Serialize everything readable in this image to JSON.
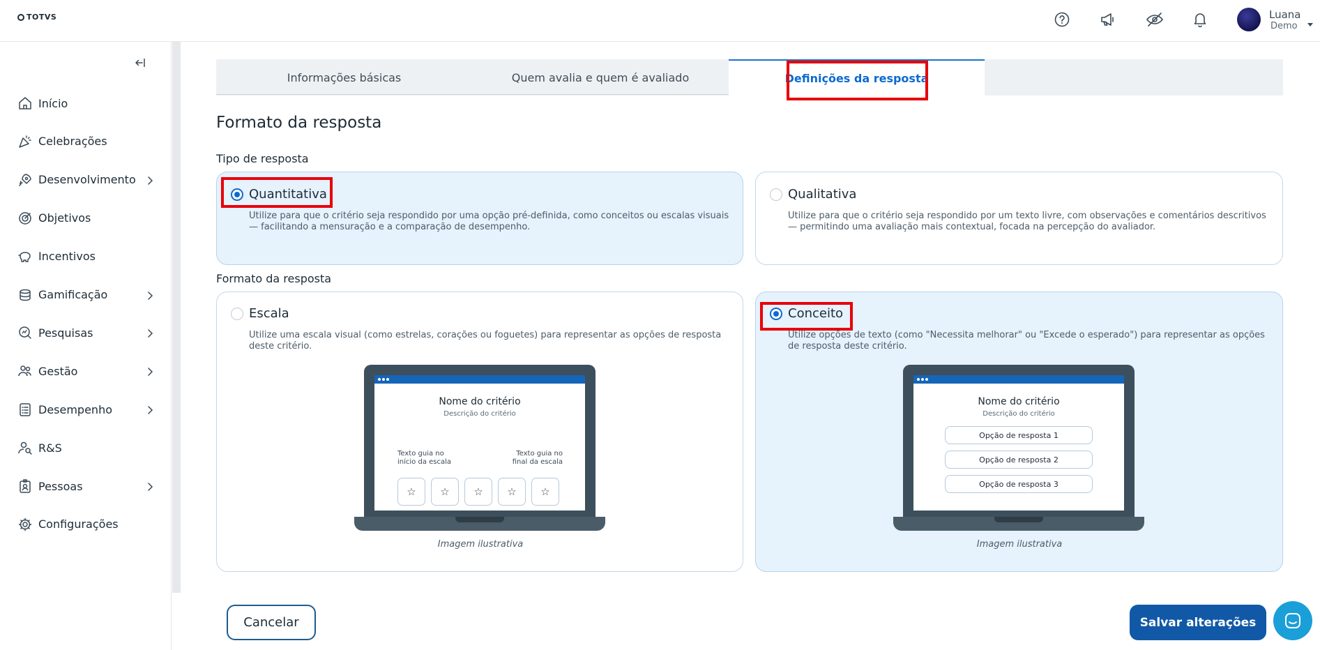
{
  "header": {
    "logo_text": "TOTVS",
    "user_name": "Luana",
    "user_role": "Demo",
    "icons": [
      "help-icon",
      "megaphone-icon",
      "hide-icon",
      "bell-icon"
    ]
  },
  "sidebar": {
    "items": [
      {
        "label": "Início",
        "icon": "home-icon",
        "chevron": false
      },
      {
        "label": "Celebrações",
        "icon": "party-icon",
        "chevron": false
      },
      {
        "label": "Desenvolvimento",
        "icon": "rocket-icon",
        "chevron": true
      },
      {
        "label": "Objetivos",
        "icon": "target-icon",
        "chevron": false
      },
      {
        "label": "Incentivos",
        "icon": "piggy-bank-icon",
        "chevron": false
      },
      {
        "label": "Gamificação",
        "icon": "coins-icon",
        "chevron": true
      },
      {
        "label": "Pesquisas",
        "icon": "search-doc-icon",
        "chevron": true
      },
      {
        "label": "Gestão",
        "icon": "people-icon",
        "chevron": true
      },
      {
        "label": "Desempenho",
        "icon": "checklist-icon",
        "chevron": true
      },
      {
        "label": "R&S",
        "icon": "user-search-icon",
        "chevron": false
      },
      {
        "label": "Pessoas",
        "icon": "badge-icon",
        "chevron": true
      },
      {
        "label": "Configurações",
        "icon": "gear-icon",
        "chevron": false
      }
    ]
  },
  "tabs": [
    {
      "label": "Informações básicas",
      "active": false
    },
    {
      "label": "Quem avalia e quem é avaliado",
      "active": false
    },
    {
      "label": "Definições da resposta",
      "active": true
    }
  ],
  "section": {
    "title": "Formato da resposta",
    "tipo_label": "Tipo de resposta",
    "formato_label": "Formato da resposta"
  },
  "tipo": {
    "quantitativa": {
      "title": "Quantitativa",
      "desc": "Utilize para que o critério seja respondido por uma opção pré-definida, como conceitos ou escalas visuais — facilitando a mensuração e a comparação de desempenho.",
      "selected": true
    },
    "qualitativa": {
      "title": "Qualitativa",
      "desc": "Utilize para que o critério seja respondido por um texto livre, com observações e comentários descritivos — permitindo uma avaliação mais contextual, focada na percepção do avaliador.",
      "selected": false
    }
  },
  "formato": {
    "escala": {
      "title": "Escala",
      "desc": "Utilize uma escala visual (como estrelas, corações ou foguetes) para representar as opções de resposta deste critério.",
      "selected": false,
      "preview": {
        "title": "Nome do critério",
        "subtitle": "Descrição do critério",
        "guide_start": "Texto guia no início da escala",
        "guide_end": "Texto guia no final da escala",
        "star": "☆"
      },
      "caption": "Imagem ilustrativa"
    },
    "conceito": {
      "title": "Conceito",
      "desc": "Utilize opções de texto (como \"Necessita melhorar\" ou \"Excede o esperado\") para representar as opções de resposta deste critério.",
      "selected": true,
      "preview": {
        "title": "Nome do critério",
        "subtitle": "Descrição do critério",
        "options": [
          "Opção de resposta 1",
          "Opção de resposta 2",
          "Opção de resposta 3"
        ]
      },
      "caption": "Imagem ilustrativa"
    }
  },
  "actions": {
    "cancel": "Cancelar",
    "save": "Salvar alterações"
  },
  "colors": {
    "accent": "#0c6ad0",
    "highlight": "#e8000a",
    "selected_card": "#e6f2fc",
    "save_button": "#1159a6",
    "chat_button": "#1a9fd9"
  }
}
